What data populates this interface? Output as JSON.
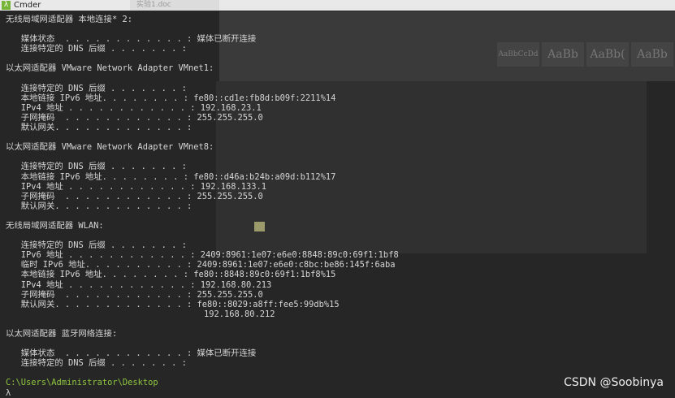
{
  "window": {
    "title": "Cmder",
    "icon": "lambda-icon",
    "icon_glyph": "λ",
    "bg_tab": "实验1.doc"
  },
  "background_styles": [
    "AaBbCcDd",
    "AaBb",
    "AaBb(",
    "AaBb"
  ],
  "console": {
    "lines": [
      "无线局域网适配器 本地连接* 2:",
      "",
      "   媒体状态  . . . . . . . . . . . . : 媒体已断开连接",
      "   连接特定的 DNS 后缀 . . . . . . . :",
      "",
      "以太网适配器 VMware Network Adapter VMnet1:",
      "",
      "   连接特定的 DNS 后缀 . . . . . . . :",
      "   本地链接 IPv6 地址. . . . . . . . : fe80::cd1e:fb8d:b09f:2211%14",
      "   IPv4 地址 . . . . . . . . . . . . : 192.168.23.1",
      "   子网掩码  . . . . . . . . . . . . : 255.255.255.0",
      "   默认网关. . . . . . . . . . . . . :",
      "",
      "以太网适配器 VMware Network Adapter VMnet8:",
      "",
      "   连接特定的 DNS 后缀 . . . . . . . :",
      "   本地链接 IPv6 地址. . . . . . . . : fe80::d46a:b24b:a09d:b112%17",
      "   IPv4 地址 . . . . . . . . . . . . : 192.168.133.1",
      "   子网掩码  . . . . . . . . . . . . : 255.255.255.0",
      "   默认网关. . . . . . . . . . . . . :",
      "",
      "无线局域网适配器 WLAN:",
      "",
      "   连接特定的 DNS 后缀 . . . . . . . :",
      "   IPv6 地址 . . . . . . . . . . . . : 2409:8961:1e07:e6e0:8848:89c0:69f1:1bf8",
      "   临时 IPv6 地址. . . . . . . . . . : 2409:8961:1e07:e6e0:c8bc:be86:145f:6aba",
      "   本地链接 IPv6 地址. . . . . . . . : fe80::8848:89c0:69f1:1bf8%15",
      "   IPv4 地址 . . . . . . . . . . . . : 192.168.80.213",
      "   子网掩码  . . . . . . . . . . . . : 255.255.255.0",
      "   默认网关. . . . . . . . . . . . . : fe80::8029:a8ff:fee5:99db%15",
      "                                       192.168.80.212",
      "",
      "以太网适配器 蓝牙网络连接:",
      "",
      "   媒体状态  . . . . . . . . . . . . : 媒体已断开连接",
      "   连接特定的 DNS 后缀 . . . . . . . :",
      ""
    ],
    "prompt_path": "C:\\Users\\Administrator\\Desktop",
    "prompt_symbol": "λ"
  },
  "watermark": "CSDN @Soobinya",
  "colors": {
    "background": "#262626",
    "text": "#d6d6d6",
    "prompt": "#8ec63f",
    "accent": "#76b538"
  }
}
